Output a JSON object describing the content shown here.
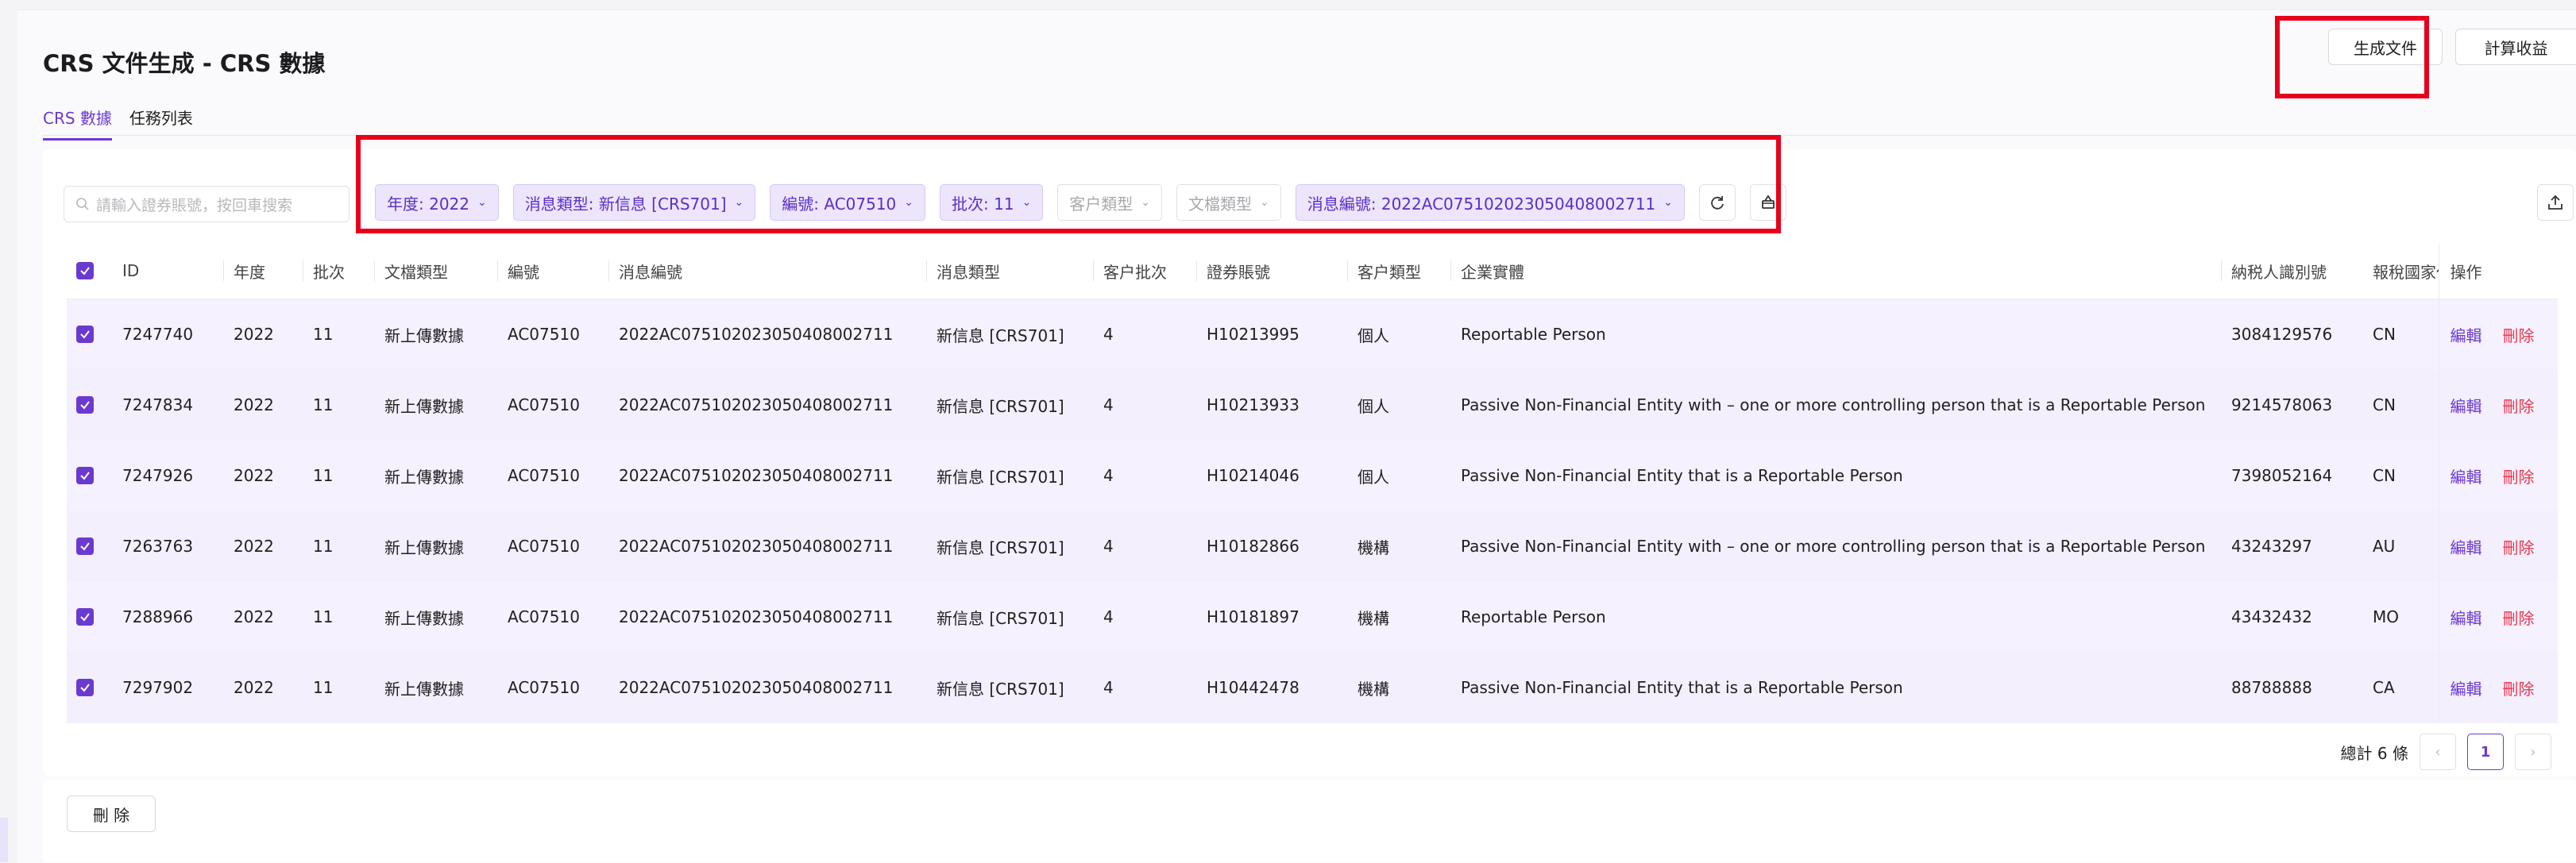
{
  "header": {
    "title": "CRS 文件生成 - CRS 數據",
    "generate_label": "生成文件",
    "calc_label": "計算收益"
  },
  "tabs": [
    {
      "label": "CRS 數據",
      "active": true
    },
    {
      "label": "任務列表",
      "active": false
    }
  ],
  "search": {
    "placeholder": "請輸入證券賬號，按回車搜索"
  },
  "filters": [
    {
      "label": "年度: 2022",
      "active": true
    },
    {
      "label": "消息類型: 新信息 [CRS701]",
      "active": true
    },
    {
      "label": "編號: AC07510",
      "active": true
    },
    {
      "label": "批次: 11",
      "active": true
    },
    {
      "label": "客户類型",
      "active": false
    },
    {
      "label": "文檔類型",
      "active": false
    },
    {
      "label": "消息編號: 2022AC075102023050408002711",
      "active": true
    }
  ],
  "columns": [
    "ID",
    "年度",
    "批次",
    "文檔類型",
    "編號",
    "消息編號",
    "消息類型",
    "客户批次",
    "證券賬號",
    "客户類型",
    "企業實體",
    "納税人識別號",
    "報稅國家代",
    "操作"
  ],
  "rows": [
    [
      "7247740",
      "2022",
      "11",
      "新上傳數據",
      "AC07510",
      "2022AC075102023050408002711",
      "新信息 [CRS701]",
      "4",
      "H10213995",
      "個人",
      "Reportable Person",
      "3084129576",
      "CN"
    ],
    [
      "7247834",
      "2022",
      "11",
      "新上傳數據",
      "AC07510",
      "2022AC075102023050408002711",
      "新信息 [CRS701]",
      "4",
      "H10213933",
      "個人",
      "Passive Non-Financial Entity with – one or more controlling person that is a Reportable Person",
      "9214578063",
      "CN"
    ],
    [
      "7247926",
      "2022",
      "11",
      "新上傳數據",
      "AC07510",
      "2022AC075102023050408002711",
      "新信息 [CRS701]",
      "4",
      "H10214046",
      "個人",
      "Passive Non-Financial Entity that is a Reportable Person",
      "7398052164",
      "CN"
    ],
    [
      "7263763",
      "2022",
      "11",
      "新上傳數據",
      "AC07510",
      "2022AC075102023050408002711",
      "新信息 [CRS701]",
      "4",
      "H10182866",
      "機構",
      "Passive Non-Financial Entity with – one or more controlling person that is a Reportable Person",
      "43243297",
      "AU"
    ],
    [
      "7288966",
      "2022",
      "11",
      "新上傳數據",
      "AC07510",
      "2022AC075102023050408002711",
      "新信息 [CRS701]",
      "4",
      "H10181897",
      "機構",
      "Reportable Person",
      "43432432",
      "MO"
    ],
    [
      "7297902",
      "2022",
      "11",
      "新上傳數據",
      "AC07510",
      "2022AC075102023050408002711",
      "新信息 [CRS701]",
      "4",
      "H10442478",
      "機構",
      "Passive Non-Financial Entity that is a Reportable Person",
      "88788888",
      "CA"
    ]
  ],
  "row_actions": {
    "edit": "編輯",
    "delete": "刪除"
  },
  "pagination": {
    "total": "總計 6 條",
    "current": "1"
  },
  "footer": {
    "delete_label": "刪 除"
  },
  "colors": {
    "accent": "#6a3ad0",
    "highlight": "#e8001b",
    "danger": "#e8384f"
  }
}
